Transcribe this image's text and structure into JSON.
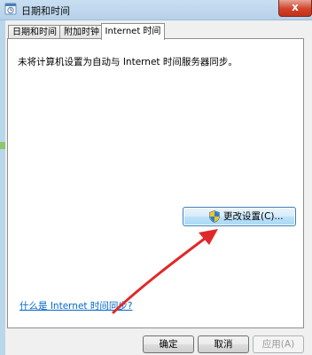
{
  "window": {
    "title": "日期和时间",
    "close_label": "x"
  },
  "tabs": [
    {
      "label": "日期和时间"
    },
    {
      "label": "附加时钟"
    },
    {
      "label": "Internet 时间"
    }
  ],
  "panel": {
    "status_text": "未将计算机设置为自动与 Internet 时间服务器同步。",
    "change_button_label": "更改设置(C)...",
    "help_link": "什么是 Internet 时间同步?"
  },
  "buttons": {
    "ok": "确定",
    "cancel": "取消",
    "apply": "应用(A)"
  },
  "annotation": {
    "arrow_color": "#e0282a"
  },
  "colors": {
    "link": "#0066cc",
    "close_button": "#d0432b"
  }
}
